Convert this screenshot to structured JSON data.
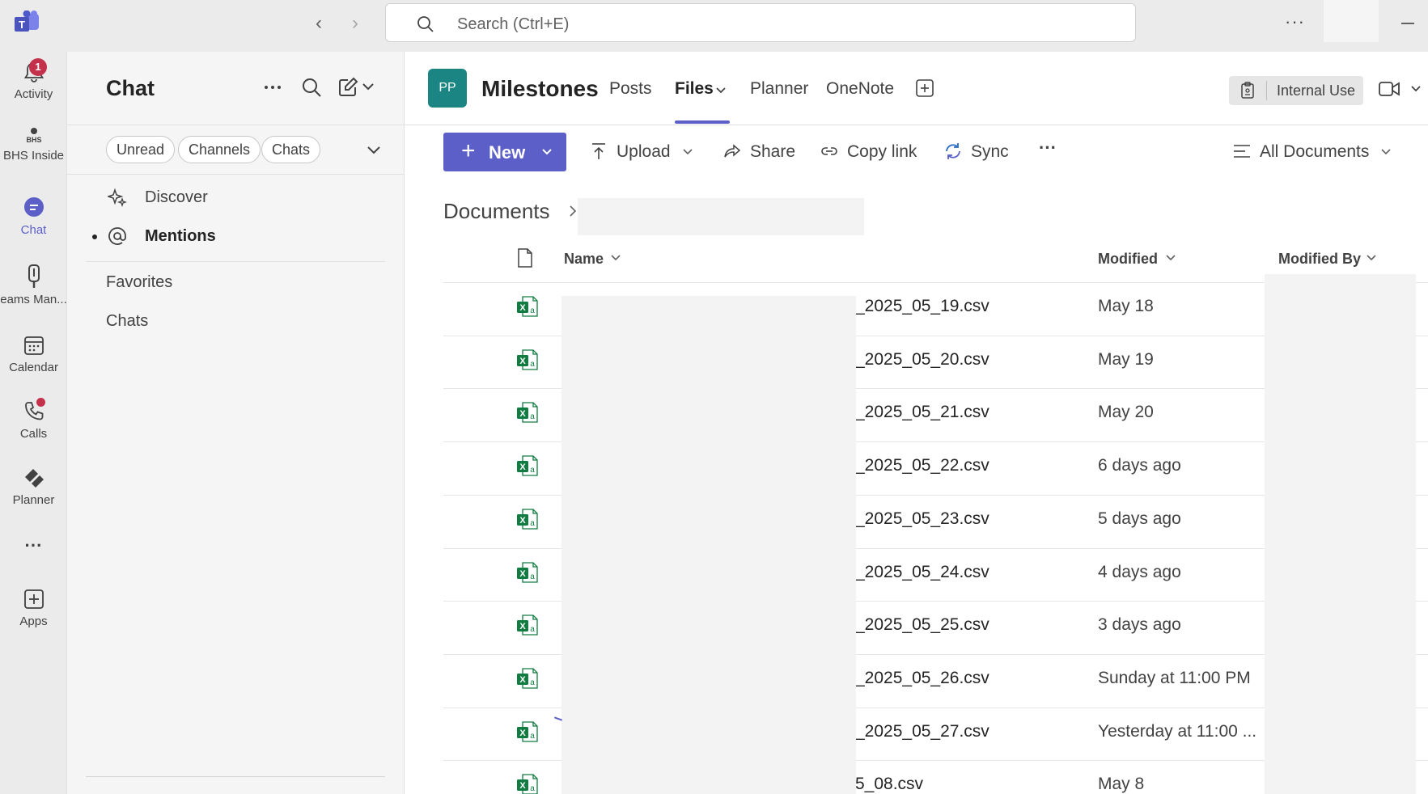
{
  "topbar": {
    "search_placeholder": "Search (Ctrl+E)",
    "more_label": "···"
  },
  "rail": {
    "items": [
      {
        "label": "Activity",
        "icon": "bell-icon",
        "badge": "1"
      },
      {
        "label": "BHS Inside",
        "icon": "bhs-logo-icon"
      },
      {
        "label": "Chat",
        "icon": "chat-icon",
        "active": true
      },
      {
        "label": "eams Man...",
        "icon": "teams-manager-icon"
      },
      {
        "label": "Calendar",
        "icon": "calendar-icon"
      },
      {
        "label": "Calls",
        "icon": "phone-icon"
      },
      {
        "label": "Planner",
        "icon": "planner-icon"
      },
      {
        "label": "Apps",
        "icon": "apps-icon"
      }
    ],
    "more_label": "···",
    "logo_text": "BHS"
  },
  "chat": {
    "title": "Chat",
    "filters": [
      "Unread",
      "Channels",
      "Chats"
    ],
    "rows": [
      {
        "label": "Discover",
        "icon": "sparkle-icon"
      },
      {
        "label": "Mentions",
        "icon": "at-icon"
      }
    ],
    "sections": [
      "Favorites",
      "Chats"
    ]
  },
  "channel": {
    "team_initials": "PP",
    "team_name": "Milestones",
    "tabs": [
      "Posts",
      "Files",
      "Planner",
      "OneNote"
    ],
    "active_tab": "Files",
    "sensitivity_label": "Internal Use"
  },
  "toolbar": {
    "new_label": "New",
    "upload_label": "Upload",
    "share_label": "Share",
    "copy_link_label": "Copy link",
    "sync_label": "Sync",
    "more_label": "···",
    "view_label": "All Documents"
  },
  "breadcrumb": {
    "root": "Documents"
  },
  "table": {
    "columns": {
      "name": "Name",
      "modified": "Modified",
      "modified_by": "Modified By"
    },
    "rows": [
      {
        "name": "_2025_05_19.csv",
        "modified": "May 18"
      },
      {
        "name": "_2025_05_20.csv",
        "modified": "May 19"
      },
      {
        "name": "_2025_05_21.csv",
        "modified": "May 20"
      },
      {
        "name": "_2025_05_22.csv",
        "modified": "6 days ago"
      },
      {
        "name": "_2025_05_23.csv",
        "modified": "5 days ago"
      },
      {
        "name": "_2025_05_24.csv",
        "modified": "4 days ago"
      },
      {
        "name": "_2025_05_25.csv",
        "modified": "3 days ago"
      },
      {
        "name": "_2025_05_26.csv",
        "modified": "Sunday at 11:00 PM"
      },
      {
        "name": "_2025_05_27.csv",
        "modified": "Yesterday at 11:00 ..."
      },
      {
        "name": "5_08.csv",
        "modified": "May 8"
      }
    ]
  },
  "colors": {
    "accent": "#5b5fc7",
    "team_avatar": "#1a8583",
    "badge": "#c4314b",
    "excel": "#107c41"
  }
}
